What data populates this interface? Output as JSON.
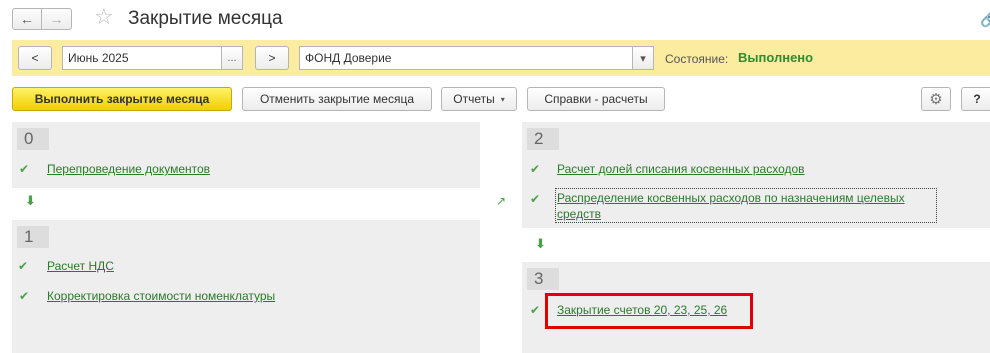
{
  "window": {
    "title": "Закрытие месяца"
  },
  "nav": {
    "back": "←",
    "forward": "→",
    "favorite": "☆",
    "link": "🔗"
  },
  "params": {
    "prev": "<",
    "period": "Июнь 2025",
    "period_select": "...",
    "next": ">",
    "organization": "ФОНД Доверие",
    "org_dropdown": "▾",
    "status_label": "Состояние:",
    "status_value": "Выполнено",
    "status_color": "#2f8c2f"
  },
  "toolbar": {
    "run": "Выполнить закрытие месяца",
    "cancel": "Отменить закрытие месяца",
    "reports": "Отчеты",
    "reports_caret": "▾",
    "refs": "Справки - расчеты",
    "settings": "⚙",
    "help": "?"
  },
  "steps": {
    "s0": {
      "num": "0",
      "items": [
        "Перепроведение документов"
      ]
    },
    "s1": {
      "num": "1",
      "items": [
        "Расчет НДС",
        "Корректировка стоимости номенклатуры"
      ]
    },
    "s2": {
      "num": "2",
      "items": [
        "Расчет долей списания косвенных расходов",
        "Распределение косвенных расходов по назначениям целевых средств"
      ]
    },
    "s3": {
      "num": "3",
      "items": [
        "Закрытие счетов 20, 23, 25, 26"
      ]
    }
  },
  "marks": {
    "check": "✔",
    "check_edit": "✔",
    "down": "⬇",
    "diag": "↗"
  },
  "colors": {
    "accent_yellow": "#fbeca0",
    "primary_btn": "#f1cf00",
    "link_green": "#2b7a2b",
    "highlight": "#e30000"
  }
}
